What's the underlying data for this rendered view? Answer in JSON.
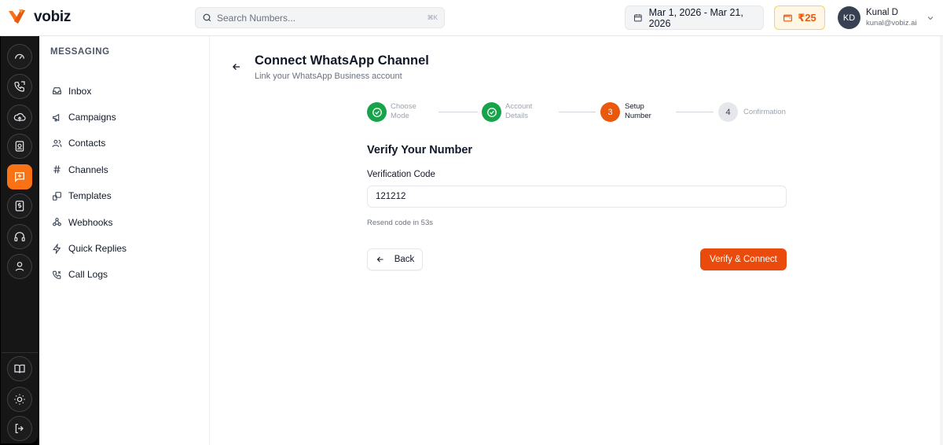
{
  "app": {
    "brand": "vobiz"
  },
  "header": {
    "search_placeholder": "Search Numbers...",
    "search_shortcut": "⌘K",
    "date_range": "Mar 1, 2026 - Mar 21, 2026",
    "wallet_balance": "₹25",
    "user": {
      "initials": "KD",
      "name": "Kunal D",
      "email": "kunal@vobiz.ai"
    }
  },
  "rail": {
    "top_icons": [
      "dashboard-icon",
      "phone-icon",
      "cloud-icon",
      "contact-card-icon",
      "messaging-icon",
      "billing-icon",
      "headset-icon",
      "user-icon"
    ],
    "active": "messaging-icon",
    "bottom_icons": [
      "book-icon",
      "sun-icon",
      "logout-icon"
    ]
  },
  "sidebar": {
    "title": "MESSAGING",
    "items": [
      {
        "label": "Inbox",
        "icon": "inbox-icon"
      },
      {
        "label": "Campaigns",
        "icon": "megaphone-icon"
      },
      {
        "label": "Contacts",
        "icon": "users-icon"
      },
      {
        "label": "Channels",
        "icon": "hash-icon"
      },
      {
        "label": "Templates",
        "icon": "templates-icon"
      },
      {
        "label": "Webhooks",
        "icon": "webhook-icon"
      },
      {
        "label": "Quick Replies",
        "icon": "zap-icon"
      },
      {
        "label": "Call Logs",
        "icon": "phone-log-icon"
      }
    ]
  },
  "main": {
    "title": "Connect WhatsApp Channel",
    "subtitle": "Link your WhatsApp Business account",
    "steps": [
      {
        "line1": "Choose",
        "line2": "Mode",
        "status": "done"
      },
      {
        "line1": "Account",
        "line2": "Details",
        "status": "done"
      },
      {
        "number": "3",
        "line1": "Setup",
        "line2": "Number",
        "status": "current"
      },
      {
        "number": "4",
        "line1": "Confirmation",
        "line2": "",
        "status": "pending"
      }
    ],
    "section_title": "Verify Your Number",
    "field_label": "Verification Code",
    "code_value": "121212",
    "resend_text": "Resend code in 53s",
    "back_label": "Back",
    "verify_label": "Verify & Connect"
  },
  "colors": {
    "accent": "#ea580c",
    "success": "#16a34a",
    "rail_bg": "#161616"
  }
}
